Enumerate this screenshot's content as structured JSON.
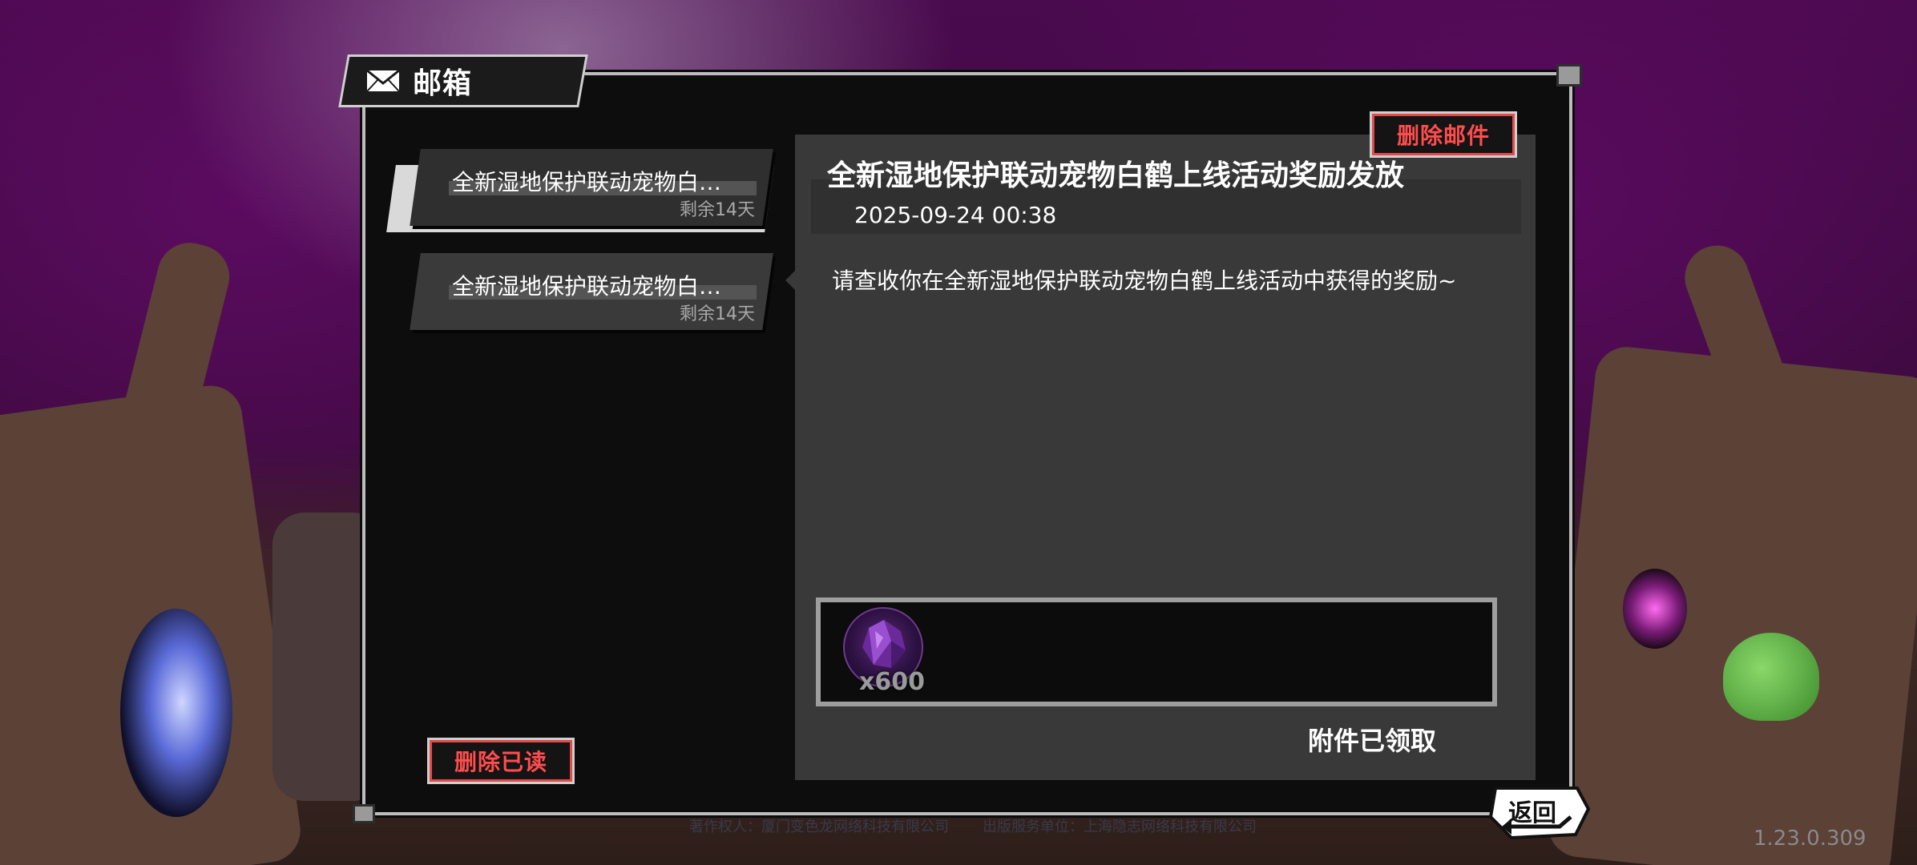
{
  "window": {
    "title": "邮箱"
  },
  "mail_list": [
    {
      "subject": "全新湿地保护联动宠物白…",
      "remaining": "剩余14天",
      "selected": true
    },
    {
      "subject": "全新湿地保护联动宠物白…",
      "remaining": "剩余14天",
      "selected": false
    }
  ],
  "buttons": {
    "delete_read": "删除已读",
    "delete_mail": "删除邮件",
    "back": "返回"
  },
  "detail": {
    "subject": "全新湿地保护联动宠物白鹤上线活动奖励发放",
    "date": "2025-09-24 00:38",
    "content": "请查收你在全新湿地保护联动宠物白鹤上线活动中获得的奖励~",
    "attachments": [
      {
        "icon": "purple-crystal-icon",
        "quantity": "x600"
      }
    ],
    "status": "附件已领取"
  },
  "footer": {
    "copyright": "著作权人：厦门变色龙网络科技有限公司",
    "publisher": "出版服务单位：上海隐志网络科技有限公司"
  },
  "version": "1.23.0.309",
  "colors": {
    "accent_red": "#e24a4a",
    "panel": "#0d0d0d",
    "detail_bg": "#393939"
  }
}
